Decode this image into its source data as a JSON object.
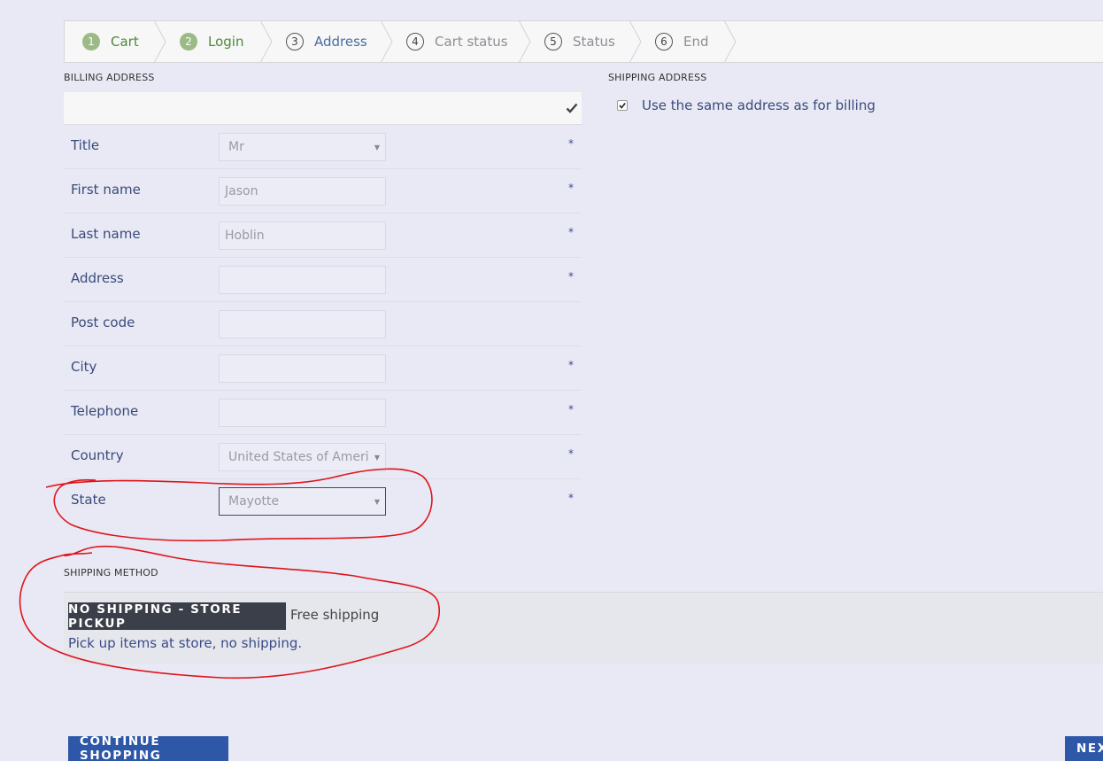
{
  "steps": [
    {
      "num": "1",
      "label": "Cart",
      "state": "done"
    },
    {
      "num": "2",
      "label": "Login",
      "state": "done"
    },
    {
      "num": "3",
      "label": "Address",
      "state": "active"
    },
    {
      "num": "4",
      "label": "Cart status",
      "state": "todo"
    },
    {
      "num": "5",
      "label": "Status",
      "state": "todo"
    },
    {
      "num": "6",
      "label": "End",
      "state": "todo"
    }
  ],
  "billing": {
    "title": "BILLING ADDRESS",
    "fields": [
      {
        "label": "Title",
        "value": "Mr",
        "type": "select",
        "required": "*"
      },
      {
        "label": "First name",
        "value": "Jason",
        "type": "text",
        "required": "*"
      },
      {
        "label": "Last name",
        "value": "Hoblin",
        "type": "text",
        "required": "*"
      },
      {
        "label": "Address",
        "value": "",
        "type": "text",
        "required": "*"
      },
      {
        "label": "Post code",
        "value": "",
        "type": "text",
        "required": ""
      },
      {
        "label": "City",
        "value": "",
        "type": "text",
        "required": "*"
      },
      {
        "label": "Telephone",
        "value": "",
        "type": "text",
        "required": "*"
      },
      {
        "label": "Country",
        "value": "United States of Ameri",
        "type": "select",
        "required": "*"
      },
      {
        "label": "State",
        "value": "Mayotte",
        "type": "select",
        "required": "*"
      }
    ]
  },
  "shipping_address": {
    "title": "SHIPPING ADDRESS",
    "same_as_billing_label": "Use the same address as for billing",
    "same_as_billing_checked": true
  },
  "shipping_method": {
    "title": "SHIPPING METHOD",
    "name": "NO SHIPPING - STORE PICKUP",
    "price": "Free shipping",
    "description": "Pick up items at store, no shipping."
  },
  "buttons": {
    "continue_shopping": "CONTINUE SHOPPING",
    "next": "NEXT"
  },
  "colors": {
    "accent": "#2e57a8",
    "done_step": "#9cba86",
    "annotation": "#e0141b"
  }
}
